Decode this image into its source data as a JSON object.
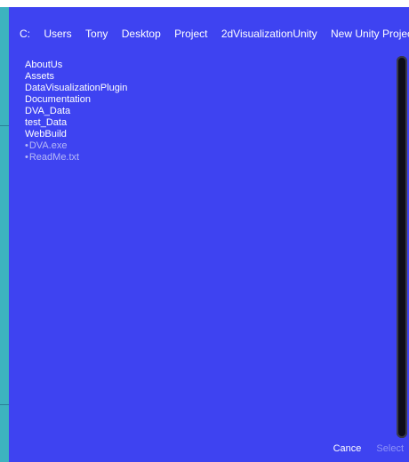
{
  "colors": {
    "panel": "#3e43f1",
    "edge": "#3db3bf",
    "text": "#ffffff",
    "file_text": "#b7b9f7",
    "disabled_text": "#8f93f7",
    "scrollbar": "#0d0d1a"
  },
  "breadcrumb": [
    "C:",
    "Users",
    "Tony",
    "Desktop",
    "Project",
    "2dVisualizationUnity",
    "New Unity Project"
  ],
  "folders": [
    "AboutUs",
    "Assets",
    "DataVisualizationPlugin",
    "Documentation",
    "DVA_Data",
    "test_Data",
    "WebBuild"
  ],
  "files": [
    "DVA.exe",
    "ReadMe.txt"
  ],
  "file_bullet": "•",
  "footer": {
    "cancel_label": "Cance",
    "select_label": "Select"
  }
}
